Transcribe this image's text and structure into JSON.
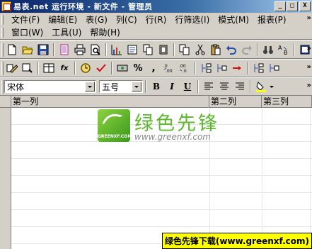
{
  "window": {
    "title": "易表.net 运行环境  -  新文件 - 管理员",
    "min_label": "_",
    "max_label": "□",
    "close_label": "X"
  },
  "menu": {
    "row1": [
      "文件(F)",
      "编辑(E)",
      "表(G)",
      "列(C)",
      "行(R)",
      "行筛选(I)",
      "模式(M)",
      "报表(P)"
    ],
    "row2": [
      "窗口(W)",
      "工具(U)",
      "帮助(H)"
    ]
  },
  "toolbar_format": {
    "font_name": "宋体",
    "font_size": "五号",
    "bold": "B",
    "italic": "I",
    "underline": "U",
    "percent": "%",
    "comma": ",",
    "fx": "fx"
  },
  "sheet": {
    "columns": [
      "第一列",
      "第二列",
      "第三列"
    ]
  },
  "watermark": {
    "title": "绿色先锋",
    "url": "www.greenxf.com",
    "logo_text": "GREENXF.COM",
    "footer": "绿色先锋下载(www.greenxf.com)"
  },
  "colors": {
    "titlebar_start": "#0a246a",
    "titlebar_end": "#a6caf0",
    "chrome": "#d4d0c8",
    "watermark_green": "#5cb82c",
    "footer_bg": "#ffff00"
  }
}
